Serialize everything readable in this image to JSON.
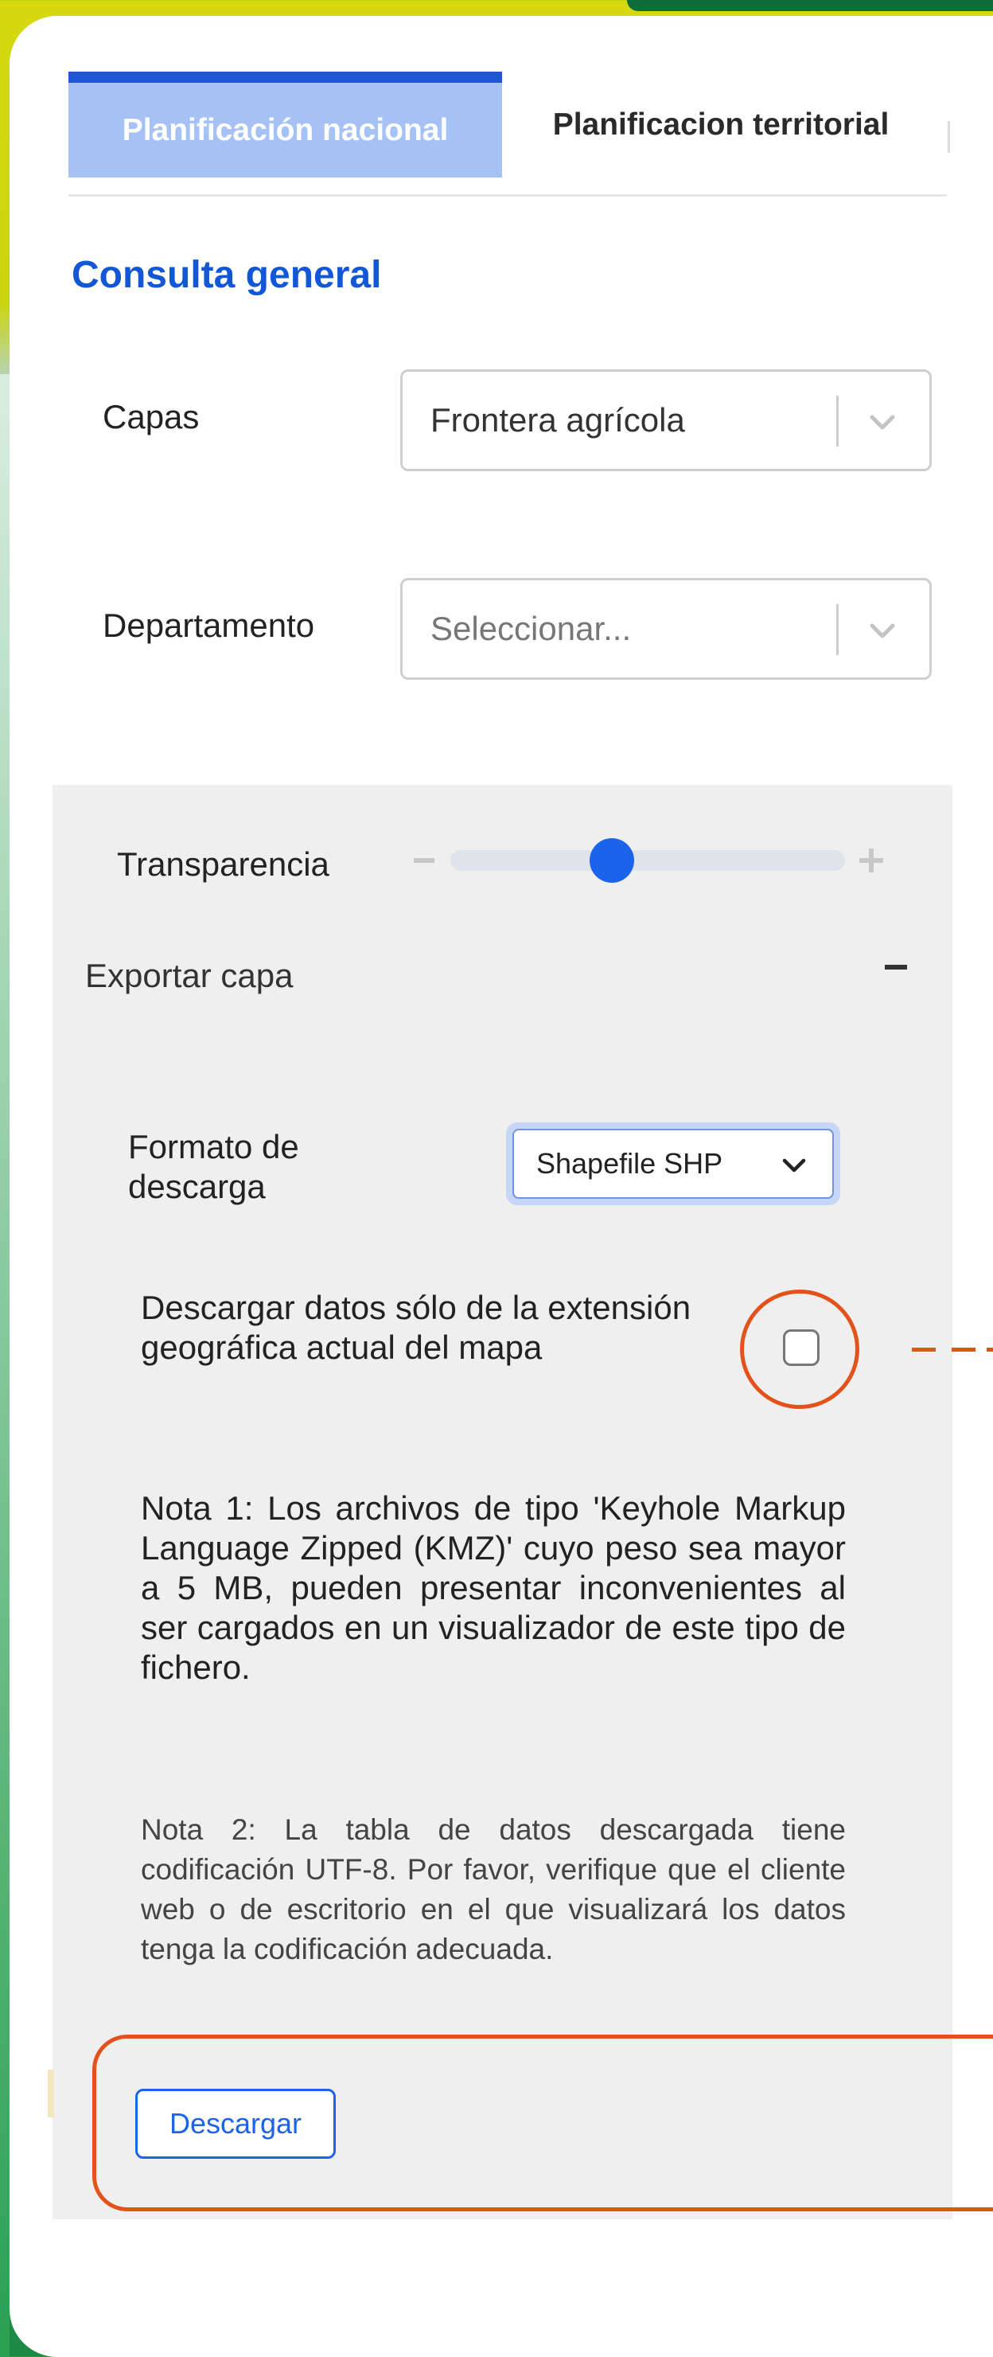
{
  "tabs": [
    {
      "label": "Planificación nacional",
      "active": true
    },
    {
      "label": "Planificacion territorial",
      "active": false
    }
  ],
  "section_title": "Consulta general",
  "layers": {
    "label": "Capas",
    "value": "Frontera agrícola"
  },
  "department": {
    "label": "Departamento",
    "placeholder": "Seleccionar..."
  },
  "transparency": {
    "label": "Transparencia",
    "level": 0.41
  },
  "export": {
    "label": "Exportar capa",
    "collapse_symbol": "-",
    "format_label": "Formato de descarga",
    "format_value": "Shapefile SHP",
    "extent_checkbox_label": "Descargar datos sólo de la extensión geográfica actual del mapa",
    "extent_checked": false,
    "note1": "Nota 1: Los archivos de tipo 'Keyhole Markup Language Zipped (KMZ)' cuyo peso sea mayor a 5 MB, pueden presentar inconvenientes al ser cargados en un visualizador de este tipo de fichero.",
    "note2": "Nota 2: La tabla de datos descargada tiene codificación UTF-8. Por favor, verifique que el cliente web o de escritorio en el que visualizará los datos tenga la codificación adecuada.",
    "download_label": "Descargar"
  },
  "colors": {
    "accent": "#1a63ea",
    "tab_active_bg": "#a6c2f4",
    "highlight": "#e4521c"
  }
}
